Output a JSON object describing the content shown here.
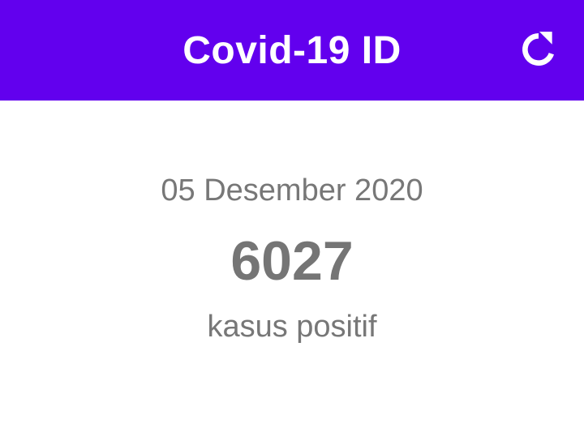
{
  "app_bar": {
    "title": "Covid-19 ID",
    "refresh_icon": "refresh-icon"
  },
  "stats": {
    "date": "05 Desember 2020",
    "count": "6027",
    "label": "kasus positif"
  },
  "colors": {
    "primary": "#6200ee",
    "text": "#777777",
    "background": "#ffffff"
  }
}
